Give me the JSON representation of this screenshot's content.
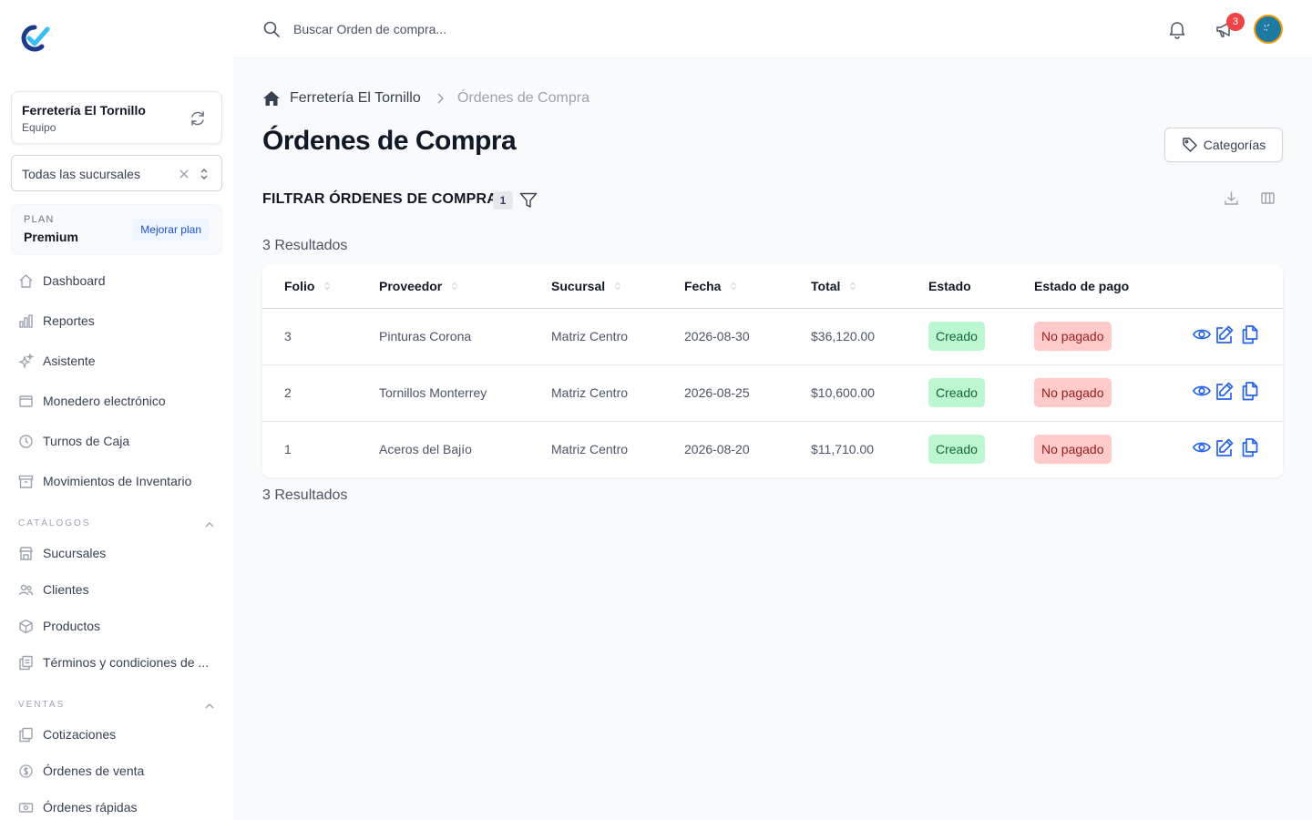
{
  "sidebar": {
    "org_name": "Ferretería El Tornillo",
    "org_sub": "Equipo",
    "branch_value": "Todas las sucursales",
    "plan_label": "PLAN",
    "plan_name": "Premium",
    "upgrade_label": "Mejorar plan",
    "items": [
      {
        "label": "Dashboard",
        "icon": "home-icon"
      },
      {
        "label": "Reportes",
        "icon": "bar-chart-icon"
      },
      {
        "label": "Asistente",
        "icon": "sparkles-icon"
      },
      {
        "label": "Monedero electrónico",
        "icon": "wallet-icon"
      },
      {
        "label": "Turnos de Caja",
        "icon": "clock-icon"
      },
      {
        "label": "Movimientos de Inventario",
        "icon": "archive-icon"
      }
    ],
    "catalogs_title": "CATÁLOGOS",
    "catalog_items": [
      {
        "label": "Sucursales",
        "icon": "store-icon"
      },
      {
        "label": "Clientes",
        "icon": "users-icon"
      },
      {
        "label": "Productos",
        "icon": "box-icon"
      },
      {
        "label": "Términos y condiciones de ...",
        "icon": "document-copy-icon"
      }
    ],
    "sales_title": "VENTAS",
    "sales_items": [
      {
        "label": "Cotizaciones",
        "icon": "copy-icon"
      },
      {
        "label": "Órdenes de venta",
        "icon": "dollar-circle-icon"
      },
      {
        "label": "Órdenes rápidas",
        "icon": "cash-icon"
      }
    ]
  },
  "topbar": {
    "search_placeholder": "Buscar Orden de compra...",
    "notification_count": "3"
  },
  "breadcrumb": {
    "parent": "Ferretería El Tornillo",
    "current": "Órdenes de Compra"
  },
  "page": {
    "title": "Órdenes de Compra",
    "categories_button": "Categorías",
    "filter_title": "FILTRAR ÓRDENES DE COMPRA",
    "filter_count": "1",
    "results_text": "3 Resultados"
  },
  "table": {
    "headers": [
      "Folio",
      "Proveedor",
      "Sucursal",
      "Fecha",
      "Total",
      "Estado",
      "Estado de pago"
    ],
    "rows": [
      {
        "folio": "3",
        "proveedor": "Pinturas Corona",
        "sucursal": "Matriz Centro",
        "fecha": "2026-08-30",
        "total": "$36,120.00",
        "estado": "Creado",
        "pago": "No pagado"
      },
      {
        "folio": "2",
        "proveedor": "Tornillos Monterrey",
        "sucursal": "Matriz Centro",
        "fecha": "2026-08-25",
        "total": "$10,600.00",
        "estado": "Creado",
        "pago": "No pagado"
      },
      {
        "folio": "1",
        "proveedor": "Aceros del Bajío",
        "sucursal": "Matriz Centro",
        "fecha": "2026-08-20",
        "total": "$11,710.00",
        "estado": "Creado",
        "pago": "No pagado"
      }
    ]
  },
  "colors": {
    "accent": "#2563eb",
    "success_bg": "#bbf7d0",
    "danger_bg": "#fecaca",
    "badge": "#ef4444"
  }
}
